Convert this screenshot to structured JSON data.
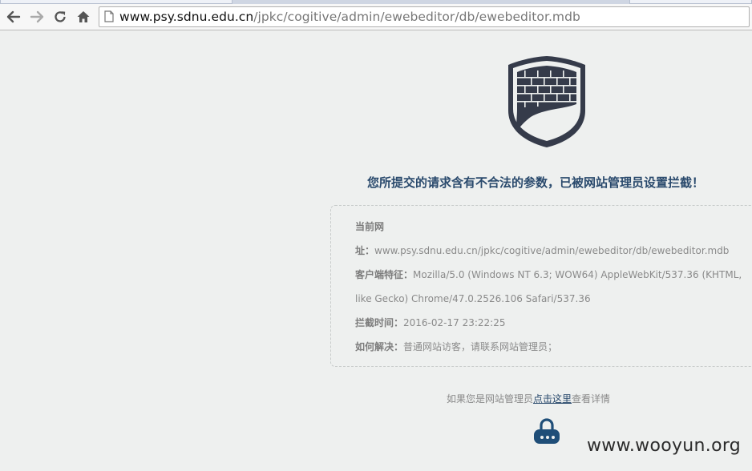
{
  "browser": {
    "url_host": "www.psy.sdnu.edu.cn",
    "url_path": "/jpkc/cogitive/admin/ewebeditor/db/ewebeditor.mdb"
  },
  "page": {
    "title": "您所提交的请求含有不合法的参数，已被网站管理员设置拦截！",
    "info": {
      "current_label": "当前网",
      "url_label": "址：",
      "url_value": "www.psy.sdnu.edu.cn/jpkc/cogitive/admin/ewebeditor/db/ewebeditor.mdb",
      "ua_label": "客户端特征：",
      "ua_value_line1": "Mozilla/5.0 (Windows NT 6.3; WOW64) AppleWebKit/537.36 (KHTML,",
      "ua_value_line2": "like Gecko) Chrome/47.0.2526.106 Safari/537.36",
      "time_label": "拦截时间：",
      "time_value": "2016-02-17 23:22:25",
      "solution_label": "如何解决：",
      "solution_value": "普通网站访客，请联系网站管理员；"
    },
    "admin_hint_prefix": "如果您是网站管理员",
    "admin_hint_link": "点击这里",
    "admin_hint_suffix": "查看详情",
    "watermark": "www.wooyun.org"
  },
  "icons": {
    "back": "back-arrow-icon",
    "forward": "forward-arrow-icon",
    "reload": "reload-icon",
    "home": "home-icon",
    "page": "page-icon",
    "shield": "firewall-shield-icon",
    "lock": "lock-icon"
  },
  "colors": {
    "title": "#2a4a6d",
    "shield": "#353b4a",
    "background": "#eef0ef"
  }
}
